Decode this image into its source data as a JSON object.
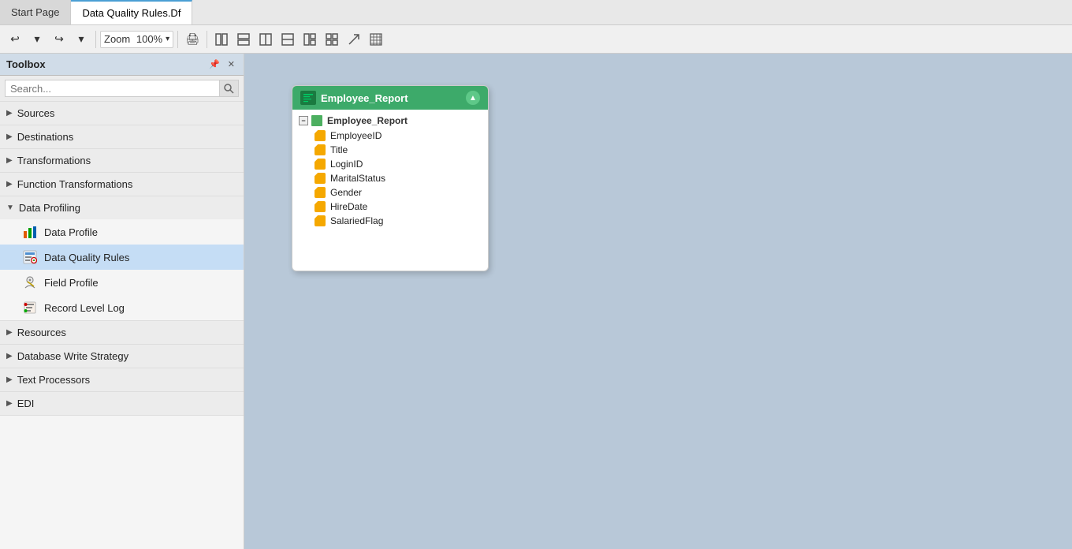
{
  "toolbox": {
    "title": "Toolbox",
    "search_placeholder": "Search...",
    "sections": [
      {
        "id": "sources",
        "label": "Sources",
        "expanded": false
      },
      {
        "id": "destinations",
        "label": "Destinations",
        "expanded": false
      },
      {
        "id": "transformations",
        "label": "Transformations",
        "expanded": false
      },
      {
        "id": "function_transformations",
        "label": "Function Transformations",
        "expanded": false
      },
      {
        "id": "data_profiling",
        "label": "Data Profiling",
        "expanded": true,
        "items": [
          {
            "id": "data_profile",
            "label": "Data Profile",
            "icon": "bar-chart"
          },
          {
            "id": "data_quality_rules",
            "label": "Data Quality Rules",
            "icon": "dqr",
            "active": true
          },
          {
            "id": "field_profile",
            "label": "Field Profile",
            "icon": "field-profile"
          },
          {
            "id": "record_level_log",
            "label": "Record Level Log",
            "icon": "record-log"
          }
        ]
      },
      {
        "id": "resources",
        "label": "Resources",
        "expanded": false
      },
      {
        "id": "database_write_strategy",
        "label": "Database Write Strategy",
        "expanded": false
      },
      {
        "id": "text_processors",
        "label": "Text Processors",
        "expanded": false
      },
      {
        "id": "edi",
        "label": "EDI",
        "expanded": false
      }
    ]
  },
  "tabs": [
    {
      "id": "start_page",
      "label": "Start Page",
      "active": false
    },
    {
      "id": "data_quality_rules_df",
      "label": "Data Quality Rules.Df",
      "active": true
    }
  ],
  "toolbar": {
    "undo_label": "↩",
    "redo_label": "↪",
    "zoom_label": "Zoom",
    "zoom_value": "100%",
    "print_label": "🖨",
    "buttons": [
      "⊞",
      "⊟",
      "⊠",
      "⊡",
      "⊢",
      "⊣",
      "↗",
      "⊞"
    ]
  },
  "node": {
    "title": "Employee_Report",
    "group": "Employee_Report",
    "fields": [
      "EmployeeID",
      "Title",
      "LoginID",
      "MaritalStatus",
      "Gender",
      "HireDate",
      "SalariedFlag"
    ]
  }
}
